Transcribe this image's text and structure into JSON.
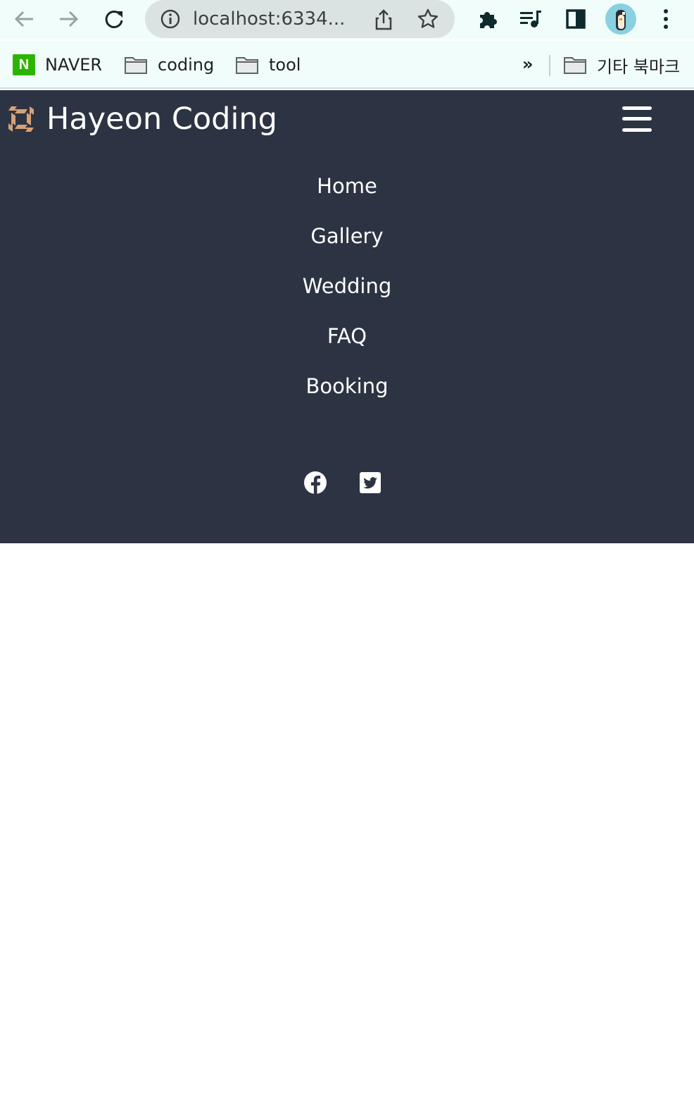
{
  "browser": {
    "url": "localhost:6334...",
    "bookmarks": [
      {
        "label": "NAVER",
        "logo_text": "N"
      },
      {
        "label": "coding"
      },
      {
        "label": "tool"
      }
    ],
    "more_label": "»",
    "other_bookmarks_label": "기타 북마크"
  },
  "site": {
    "brand": "Hayeon Coding",
    "nav": [
      "Home",
      "Gallery",
      "Wedding",
      "FAQ",
      "Booking"
    ],
    "social": [
      "facebook-icon",
      "twitter-icon"
    ],
    "colors": {
      "background": "#2c3443",
      "logo": "#d9a077",
      "text": "#ffffff"
    }
  }
}
